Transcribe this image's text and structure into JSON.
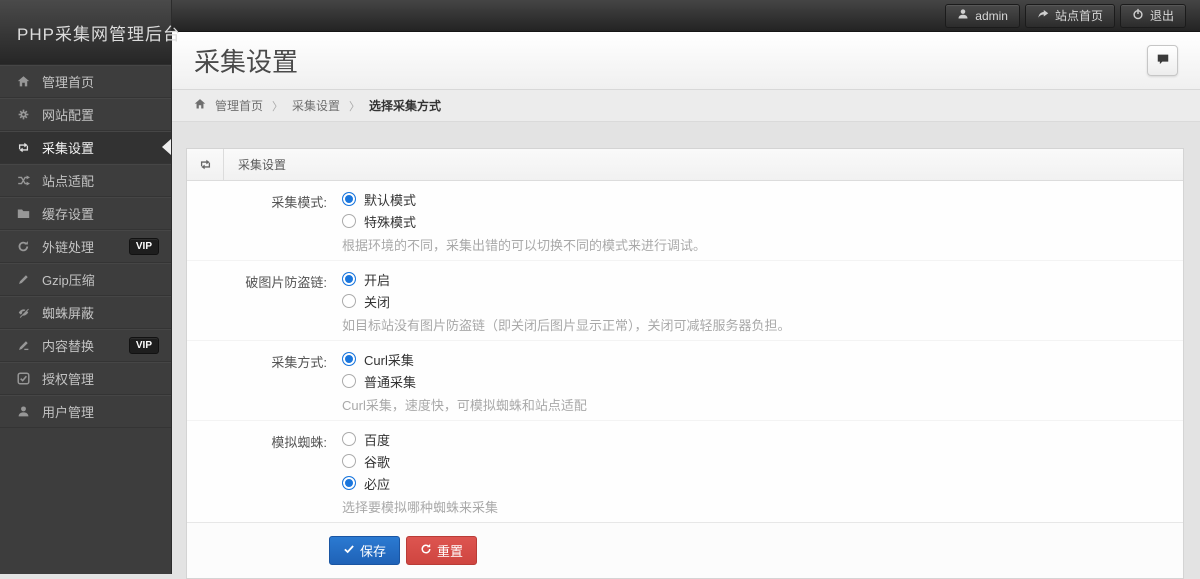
{
  "brand": {
    "title": "PHP采集网管理后台"
  },
  "topbar": {
    "user": "admin",
    "site_home": "站点首页",
    "logout": "退出"
  },
  "sidebar": {
    "vip_badge": "VIP",
    "items": [
      {
        "key": "home",
        "label": "管理首页",
        "icon": "home-icon",
        "vip": false,
        "active": false
      },
      {
        "key": "site-config",
        "label": "网站配置",
        "icon": "gear-icon",
        "vip": false,
        "active": false
      },
      {
        "key": "collect-settings",
        "label": "采集设置",
        "icon": "repeat-icon",
        "vip": false,
        "active": true
      },
      {
        "key": "site-adapt",
        "label": "站点适配",
        "icon": "shuffle-icon",
        "vip": false,
        "active": false
      },
      {
        "key": "cache-settings",
        "label": "缓存设置",
        "icon": "folder-icon",
        "vip": false,
        "active": false
      },
      {
        "key": "external-links",
        "label": "外链处理",
        "icon": "refresh-icon",
        "vip": true,
        "active": false
      },
      {
        "key": "gzip",
        "label": "Gzip压缩",
        "icon": "pencil-icon",
        "vip": false,
        "active": false
      },
      {
        "key": "spider-block",
        "label": "蜘蛛屏蔽",
        "icon": "eye-slash-icon",
        "vip": false,
        "active": false
      },
      {
        "key": "content-replace",
        "label": "内容替换",
        "icon": "edit-icon",
        "vip": true,
        "active": false
      },
      {
        "key": "auth-manage",
        "label": "授权管理",
        "icon": "check-square-icon",
        "vip": false,
        "active": false
      },
      {
        "key": "user-manage",
        "label": "用户管理",
        "icon": "user-icon",
        "vip": false,
        "active": false
      }
    ]
  },
  "header": {
    "title": "采集设置"
  },
  "breadcrumb": {
    "items": [
      "管理首页",
      "采集设置",
      "选择采集方式"
    ]
  },
  "panel": {
    "title": "采集设置"
  },
  "form": {
    "fields": [
      {
        "key": "collect-mode",
        "label": "采集模式:",
        "options": [
          {
            "text": "默认模式",
            "selected": true
          },
          {
            "text": "特殊模式",
            "selected": false
          }
        ],
        "help": "根据环境的不同，采集出错的可以切换不同的模式来进行调试。"
      },
      {
        "key": "image-antileech",
        "label": "破图片防盗链:",
        "options": [
          {
            "text": "开启",
            "selected": true
          },
          {
            "text": "关闭",
            "selected": false
          }
        ],
        "help": "如目标站没有图片防盗链（即关闭后图片显示正常），关闭可减轻服务器负担。"
      },
      {
        "key": "collect-method",
        "label": "采集方式:",
        "options": [
          {
            "text": "Curl采集",
            "selected": true
          },
          {
            "text": "普通采集",
            "selected": false
          }
        ],
        "help": "Curl采集，速度快，可模拟蜘蛛和站点适配"
      },
      {
        "key": "simulate-spider",
        "label": "模拟蜘蛛:",
        "options": [
          {
            "text": "百度",
            "selected": false
          },
          {
            "text": "谷歌",
            "selected": false
          },
          {
            "text": "必应",
            "selected": true
          }
        ],
        "help": "选择要模拟哪种蜘蛛来采集"
      }
    ],
    "buttons": {
      "save": "保存",
      "reset": "重置"
    }
  },
  "colors": {
    "accent_blue": "#1a76dd",
    "save_button": "#2672c9",
    "reset_button": "#d9534f",
    "sidebar_bg": "#3d3d3d",
    "content_bg": "#e3e3e3"
  }
}
